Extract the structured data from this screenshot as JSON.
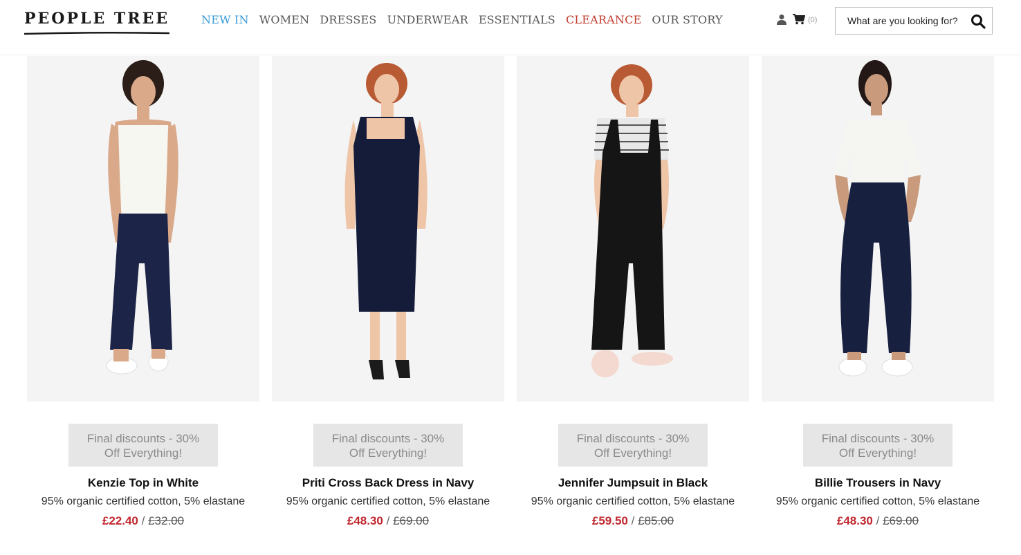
{
  "brand": {
    "logo_text": "PEOPLE TREE"
  },
  "nav": {
    "items": [
      {
        "label": "NEW IN",
        "style": "new"
      },
      {
        "label": "WOMEN",
        "style": ""
      },
      {
        "label": "DRESSES",
        "style": ""
      },
      {
        "label": "UNDERWEAR",
        "style": ""
      },
      {
        "label": "ESSENTIALS",
        "style": ""
      },
      {
        "label": "CLEARANCE",
        "style": "clear"
      },
      {
        "label": "OUR STORY",
        "style": ""
      }
    ]
  },
  "header": {
    "cart_count": "(0)",
    "search_placeholder": "What are you looking for?"
  },
  "products": [
    {
      "badge_line1": "Final discounts - 30%",
      "badge_line2": "Off Everything!",
      "name": "Kenzie Top in White",
      "material": "95% organic certified cotton, 5% elastane",
      "price_now": "£22.40",
      "price_sep": "/",
      "price_was": "£32.00"
    },
    {
      "badge_line1": "Final discounts - 30%",
      "badge_line2": "Off Everything!",
      "name": "Priti Cross Back Dress in Navy",
      "material": "95% organic certified cotton, 5% elastane",
      "price_now": "£48.30",
      "price_sep": "/",
      "price_was": "£69.00"
    },
    {
      "badge_line1": "Final discounts - 30%",
      "badge_line2": "Off Everything!",
      "name": "Jennifer Jumpsuit in Black",
      "material": "95% organic certified cotton, 5% elastane",
      "price_now": "£59.50",
      "price_sep": "/",
      "price_was": "£85.00"
    },
    {
      "badge_line1": "Final discounts - 30%",
      "badge_line2": "Off Everything!",
      "name": "Billie Trousers in Navy",
      "material": "95% organic certified cotton, 5% elastane",
      "price_now": "£48.30",
      "price_sep": "/",
      "price_was": "£69.00"
    }
  ],
  "colors": {
    "accent_blue": "#3a9bd5",
    "clearance_red": "#c0392b",
    "price_red": "#c0262d",
    "badge_bg": "#e6e6e6"
  }
}
